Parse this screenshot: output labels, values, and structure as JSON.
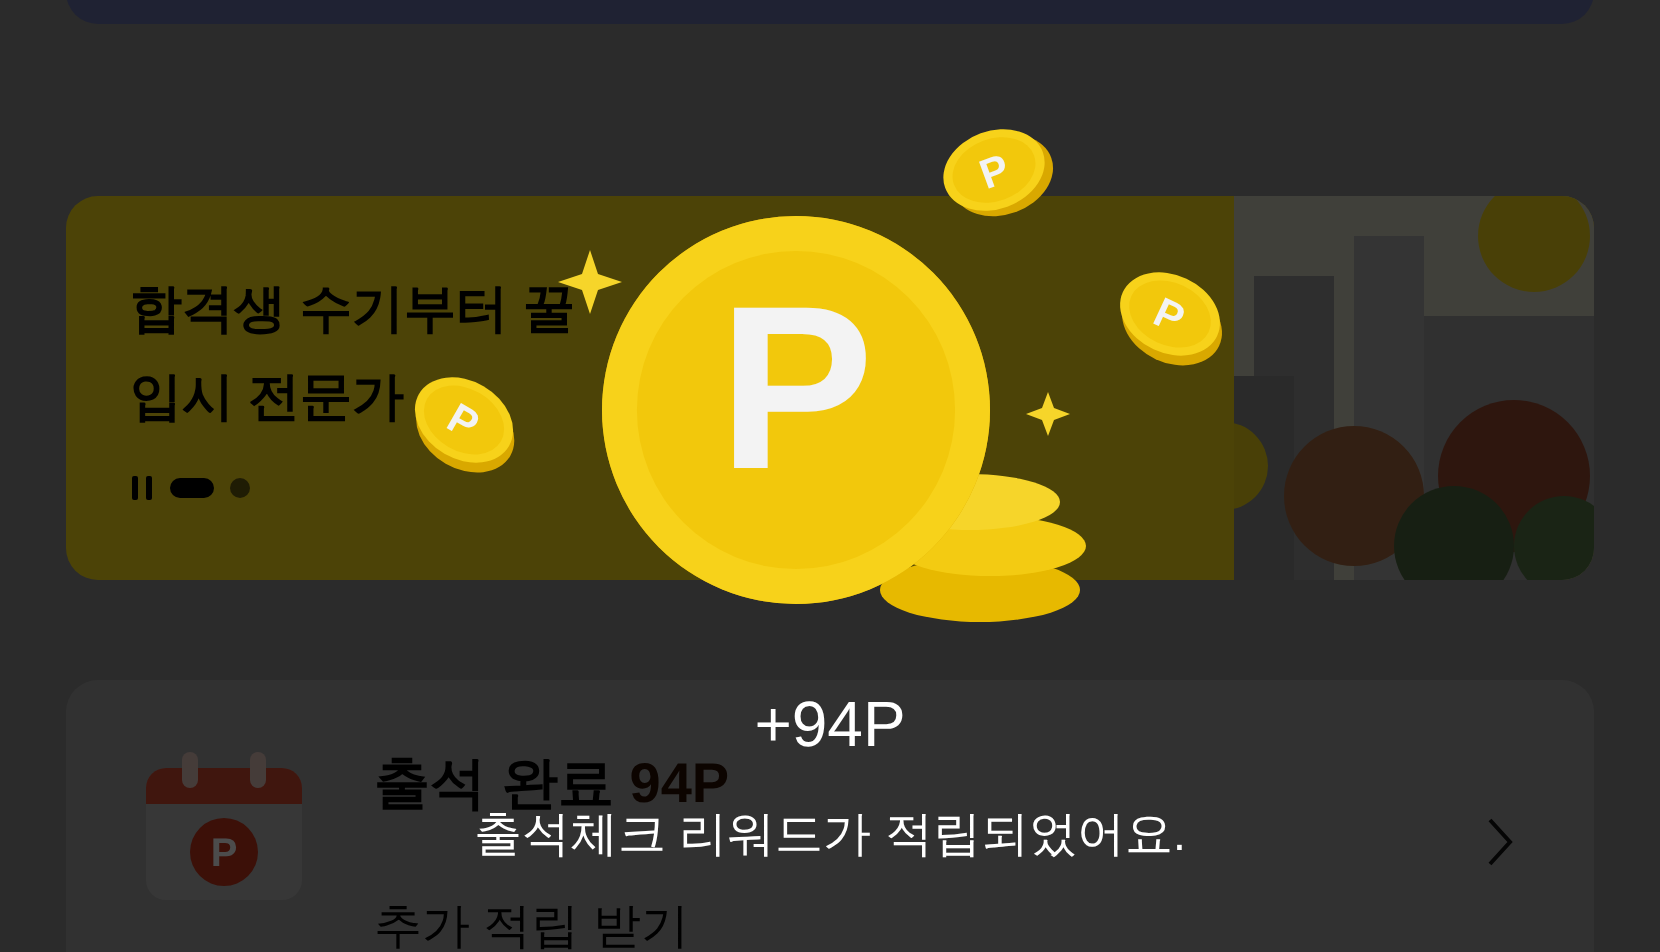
{
  "banner": {
    "title_lines": [
      "합격생 수기부터 꿀",
      "입시 전문가"
    ],
    "pages": [
      {
        "selected": true
      },
      {
        "selected": false
      }
    ]
  },
  "attendance": {
    "icon_letter": "P",
    "title": "출석 완료",
    "points": "94P",
    "subtitle": "추가 적립 받기"
  },
  "popup": {
    "coins": [
      {
        "kind": "big",
        "letter": "P"
      },
      {
        "kind": "small",
        "letter": "P"
      },
      {
        "kind": "small",
        "letter": "P"
      },
      {
        "kind": "small",
        "letter": "P"
      }
    ],
    "amount": "+94P",
    "message": "출석체크 리워드가 적립되었어요."
  }
}
